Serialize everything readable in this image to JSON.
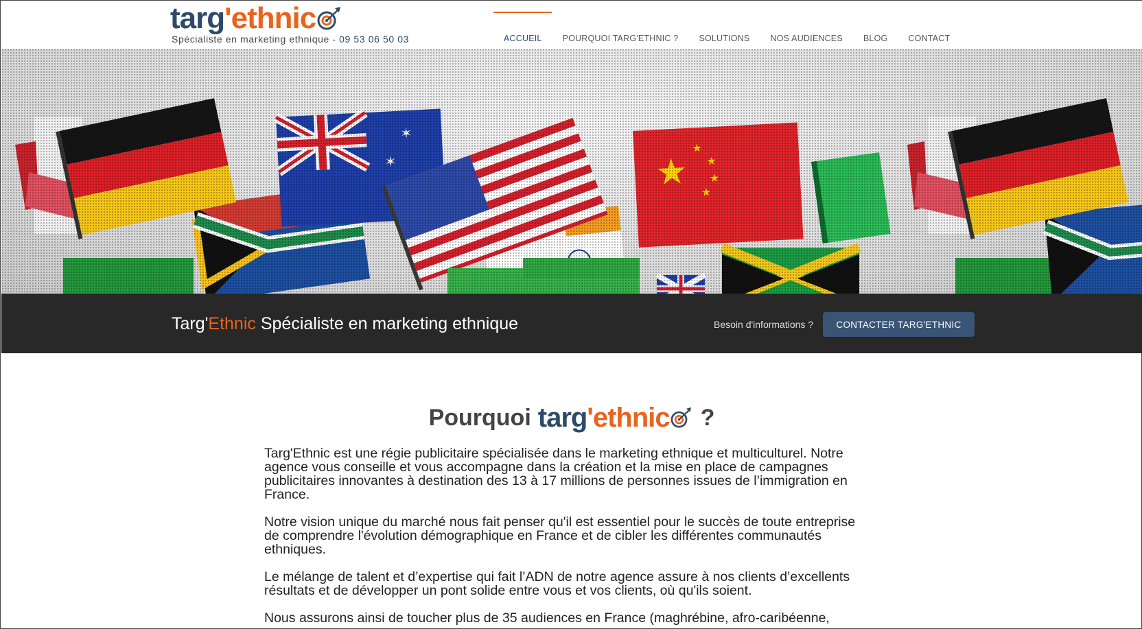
{
  "header": {
    "logo": {
      "part1": "targ",
      "apostrophe": "'",
      "part2": "ethnic",
      "icon": "target-arrow-icon"
    },
    "tagline": "Spécialiste en marketing ethnique - ",
    "phone": "09 53 06 50 03"
  },
  "nav": {
    "items": [
      {
        "label": "ACCUEIL",
        "active": true
      },
      {
        "label": "POURQUOI TARG'ETHNIC ?"
      },
      {
        "label": "SOLUTIONS"
      },
      {
        "label": "NOS AUDIENCES"
      },
      {
        "label": "BLOG"
      },
      {
        "label": "CONTACT"
      }
    ]
  },
  "bar": {
    "title_part1": "Targ'",
    "title_part2": "Ethnic",
    "title_part3": " Spécialiste en marketing ethnique",
    "info": "Besoin d'informations ?",
    "button": "CONTACTER TARG'ETHNIC"
  },
  "section": {
    "title_prefix": "Pourquoi",
    "title_suffix": "?",
    "paragraphs": [
      "Targ'Ethnic est une régie publicitaire spécialisée dans le marketing ethnique et multiculturel. Notre agence vous conseille et vous accompagne dans la création et la mise en place de campagnes publicitaires innovantes à destination des 13 à 17 millions de personnes issues de l’immigration en France.",
      "Notre vision unique du marché nous fait penser qu'il est essentiel pour le succès de toute entreprise de comprendre l'évolution démographique en France et de cibler les différentes communautés ethniques.",
      "Le mélange de talent et d’expertise qui fait l’ADN de notre agence assure à nos clients d’excellents résultats et de développer un pont solide entre vous et vos clients, où qu'ils soient.",
      "Nous assurons ainsi de toucher plus de 35 audiences en France (maghrébine, afro-caribéenne,"
    ]
  },
  "colors": {
    "navy": "#2d4a6a",
    "orange": "#e8641e",
    "bar": "#282828",
    "button": "#3a5475"
  }
}
